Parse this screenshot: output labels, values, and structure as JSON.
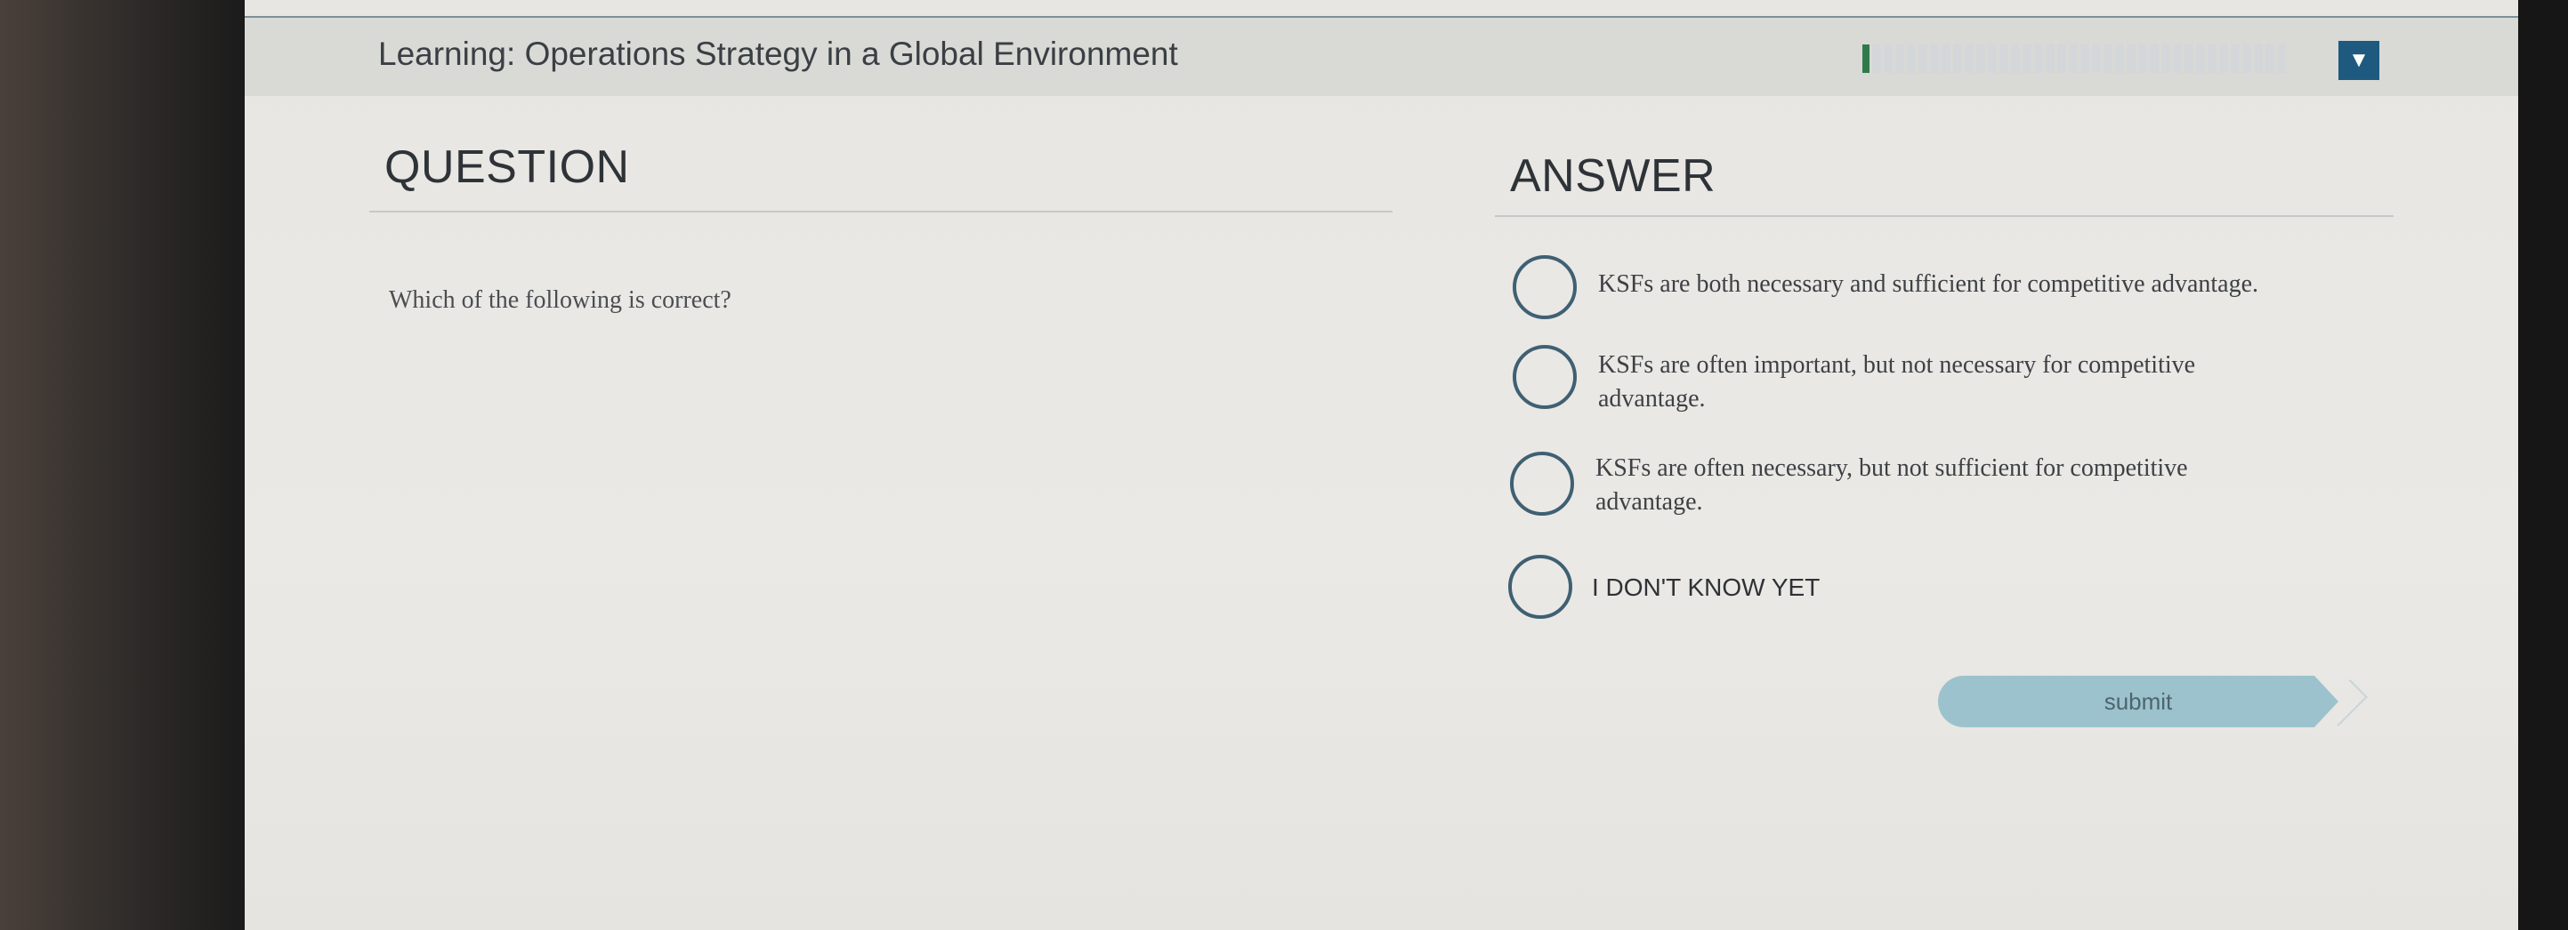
{
  "header": {
    "title": "Learning: Operations Strategy in a Global Environment",
    "progress_fraction": 0.02,
    "menu_icon": "triangle-down-icon"
  },
  "question": {
    "heading": "QUESTION",
    "prompt": "Which of the following is correct?"
  },
  "answer": {
    "heading": "ANSWER",
    "options": [
      {
        "label": "KSFs are both necessary and sufficient for competitive advantage."
      },
      {
        "line1": "KSFs are often important, but not necessary for competitive",
        "line2": "advantage."
      },
      {
        "line1": "KSFs are often necessary, but not sufficient for competitive",
        "line2": "advantage."
      },
      {
        "label": "I DON'T KNOW YET"
      }
    ]
  },
  "submit": {
    "label": "submit"
  },
  "colors": {
    "accent": "#1e5a7f",
    "progress_fill": "#2f7a4a",
    "radio_border": "#3f6073",
    "submit_bg": "#9cc3cd"
  }
}
